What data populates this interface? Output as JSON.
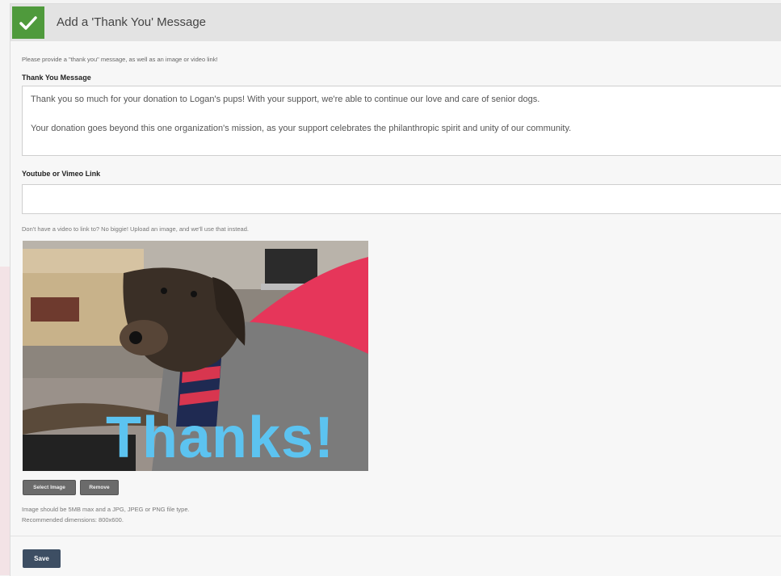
{
  "header": {
    "title": "Add a 'Thank You' Message",
    "status_icon": "checkmark-icon",
    "accent_color": "#4f9a3c"
  },
  "form": {
    "instruction": "Please provide a \"thank you\" message, as well as an image or video link!",
    "message_label": "Thank You Message",
    "message_paragraphs": [
      "Thank you so much for your donation to Logan's pups! With your support, we're able to continue our love and care of senior dogs.",
      "Your donation goes beyond this one organization's mission, as your support celebrates the philanthropic spirit and unity of our community."
    ],
    "link_label": "Youtube or Vimeo Link",
    "link_value": "",
    "upload_hint": "Don't have a video to link to? No biggie! Upload an image, and we'll use that instead.",
    "image_overlay_text": "Thanks!",
    "select_image_label": "Select Image",
    "remove_label": "Remove",
    "requirement_line1": "Image should be 5MB max and a JPG, JPEG or PNG file type.",
    "requirement_line2": "Recommended dimensions: 800x600.",
    "save_label": "Save",
    "save_color": "#3d4e63"
  }
}
